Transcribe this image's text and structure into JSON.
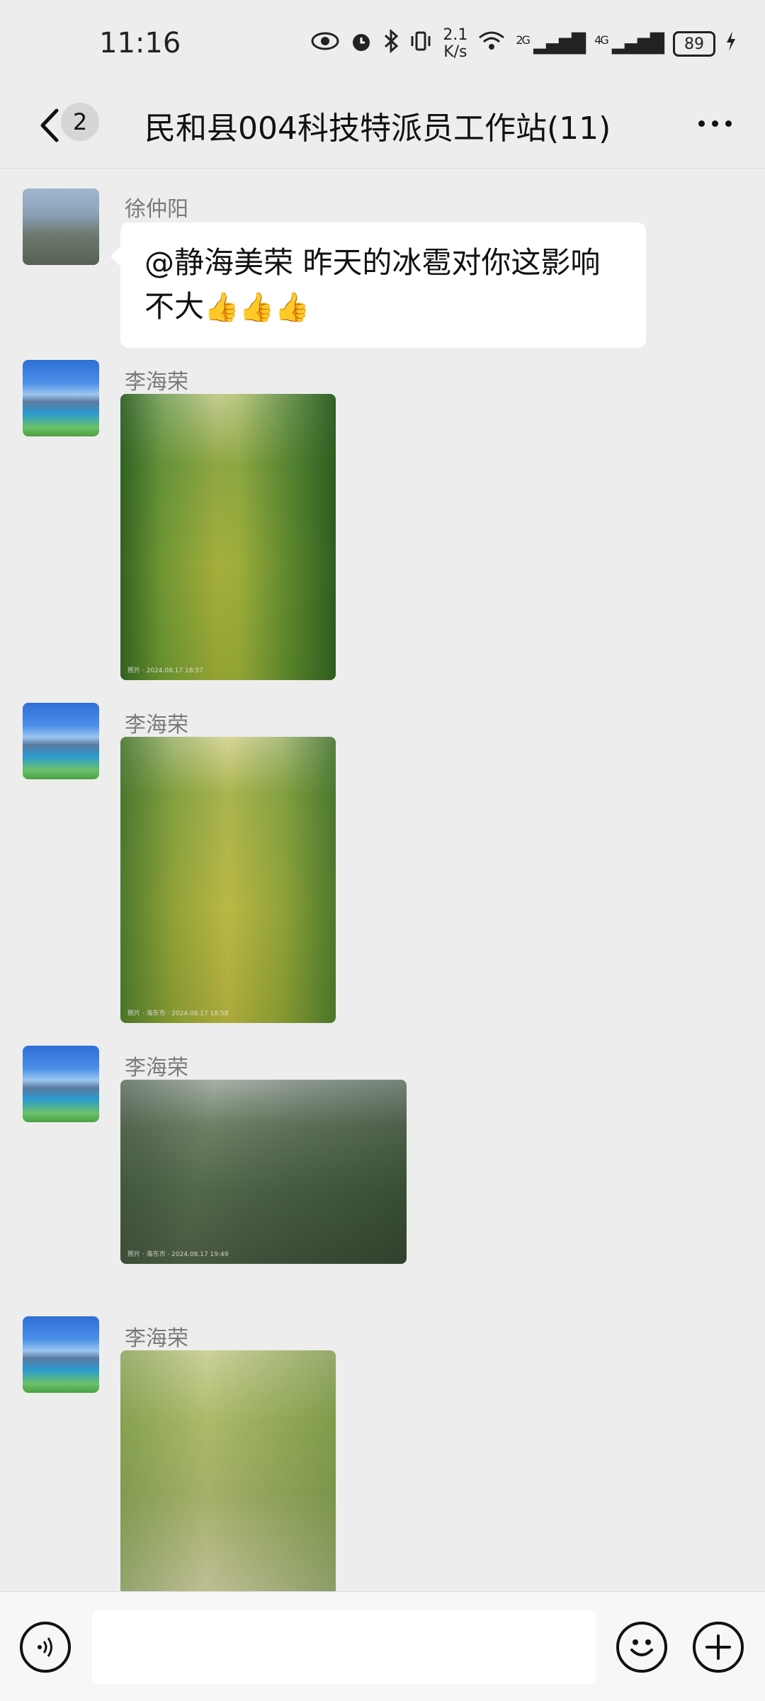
{
  "status_bar": {
    "time": "11:16",
    "net_speed_value": "2.1",
    "net_speed_unit": "K/s",
    "signal_1_label": "2G",
    "signal_2_label": "4G",
    "battery": "89"
  },
  "header": {
    "unread_count": "2",
    "title": "民和县004科技特派员工作站(11)"
  },
  "messages": [
    {
      "sender": "徐仲阳",
      "text": "@静海美荣  昨天的冰雹对你这影响不大",
      "emoji": "👍👍👍"
    },
    {
      "sender": "李海荣",
      "photo_stamp": "照片 · 2024.08.17 18:57"
    },
    {
      "sender": "李海荣",
      "photo_stamp": "照片 · 海东市 · 2024.08.17 18:58"
    },
    {
      "sender": "李海荣",
      "photo_stamp": "照片 · 海东市 · 2024.08.17 19:49"
    },
    {
      "sender": "李海荣"
    }
  ],
  "input": {
    "placeholder": ""
  }
}
